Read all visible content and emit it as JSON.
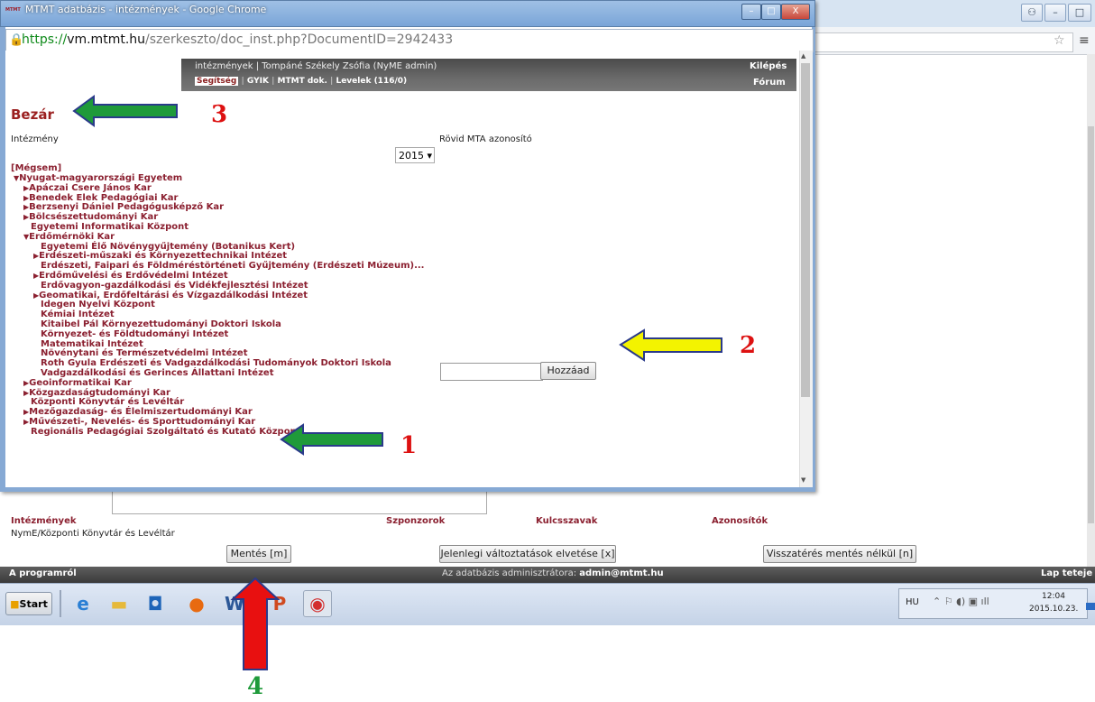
{
  "browser": {
    "window_title": "MTMT adatbázis - intézmények - Google Chrome",
    "favicon_text": "MTMT",
    "url_scheme": "https://",
    "url_host": "vm.mtmt.hu",
    "url_path": "/szerkeszto/doc_inst.php?DocumentID=2942433",
    "minimize": "–",
    "maximize": "□",
    "close": "X"
  },
  "header": {
    "user_line": "intézmények | Tompáné Székely Zsófia (NyME admin)",
    "nav": [
      "Segítség",
      "GYIK",
      "MTMT dok.",
      "Levelek (116/0)"
    ],
    "logout": "Kilépés",
    "forum": "Fórum"
  },
  "form": {
    "close_label": "Bezár",
    "institution_label": "Intézmény",
    "short_id_label": "Rövid MTA azonosító",
    "year": "2015 ▾",
    "cancel_label": "[Mégsem]",
    "add_button": "Hozzáad",
    "add_input_value": ""
  },
  "tree": [
    {
      "level": 0,
      "marker": "▼",
      "label": "Nyugat-magyarországi Egyetem"
    },
    {
      "level": 1,
      "marker": "▶",
      "label": "Apáczai Csere János Kar"
    },
    {
      "level": 1,
      "marker": "▶",
      "label": "Benedek Elek Pedagógiai Kar"
    },
    {
      "level": 1,
      "marker": "▶",
      "label": "Berzsenyi Dániel Pedagógusképző Kar"
    },
    {
      "level": 1,
      "marker": "▶",
      "label": "Bölcsészettudományi Kar"
    },
    {
      "level": 1,
      "marker": "",
      "label": "Egyetemi Informatikai Központ"
    },
    {
      "level": 1,
      "marker": "▼",
      "label": "Erdőmérnöki Kar"
    },
    {
      "level": 2,
      "marker": "",
      "label": "Egyetemi Élő Növénygyűjtemény (Botanikus Kert)"
    },
    {
      "level": 2,
      "marker": "▶",
      "label": "Erdészeti-műszaki és Környezettechnikai Intézet"
    },
    {
      "level": 2,
      "marker": "",
      "label": "Erdészeti, Faipari és Földméréstörténeti Gyűjtemény (Erdészeti Múzeum)..."
    },
    {
      "level": 2,
      "marker": "▶",
      "label": "Erdőművelési és Erdővédelmi Intézet"
    },
    {
      "level": 2,
      "marker": "",
      "label": "Erdővagyon-gazdálkodási és Vidékfejlesztési Intézet"
    },
    {
      "level": 2,
      "marker": "▶",
      "label": "Geomatikai, Erdőfeltárási és Vízgazdálkodási Intézet"
    },
    {
      "level": 2,
      "marker": "",
      "label": "Idegen Nyelvi Központ"
    },
    {
      "level": 2,
      "marker": "",
      "label": "Kémiai Intézet"
    },
    {
      "level": 2,
      "marker": "",
      "label": "Kitaibel Pál Környezettudományi Doktori Iskola"
    },
    {
      "level": 2,
      "marker": "",
      "label": "Környezet- és Földtudományi Intézet"
    },
    {
      "level": 2,
      "marker": "",
      "label": "Matematikai Intézet"
    },
    {
      "level": 2,
      "marker": "",
      "label": "Növénytani és Természetvédelmi Intézet"
    },
    {
      "level": 2,
      "marker": "",
      "label": "Roth Gyula Erdészeti és Vadgazdálkodási Tudományok Doktori Iskola"
    },
    {
      "level": 2,
      "marker": "",
      "label": "Vadgazdálkodási és Gerinces Állattani Intézet"
    },
    {
      "level": 1,
      "marker": "▶",
      "label": "Geoinformatikai Kar"
    },
    {
      "level": 1,
      "marker": "▶",
      "label": "Közgazdaságtudományi Kar"
    },
    {
      "level": 1,
      "marker": "",
      "label": "Központi Könyvtár és Levéltár"
    },
    {
      "level": 1,
      "marker": "▶",
      "label": "Mezőgazdaság- és Élelmiszertudományi Kar"
    },
    {
      "level": 1,
      "marker": "▶",
      "label": "Művészeti-, Nevelés- és Sporttudományi Kar"
    },
    {
      "level": 1,
      "marker": "",
      "label": "Regionális Pedagógiai Szolgáltató és Kutató Központ"
    }
  ],
  "page": {
    "sections": [
      "Intézmények",
      "Szponzorok",
      "Kulcsszavak",
      "Azonosítók"
    ],
    "institution_path": "NymE/Központi Könyvtár és Levéltár",
    "save_button": "Mentés [m]",
    "discard_button": "Jelenlegi változtatások elvetése [x]",
    "back_button": "Visszatérés mentés nélkül [n]",
    "footer_left": "A programról",
    "footer_mid_prefix": "Az adatbázis adminisztrátora: ",
    "footer_mid_email": "admin@mtmt.hu",
    "footer_right": "Lap teteje"
  },
  "taskbar": {
    "start": "Start",
    "apps": [
      "internet-explorer-icon",
      "file-explorer-icon",
      "outlook-icon",
      "firefox-icon",
      "word-icon",
      "powerpoint-icon",
      "chrome-icon"
    ],
    "lang": "HU",
    "time": "12:04",
    "date": "2015.10.23."
  },
  "annotations": [
    {
      "number": "1",
      "color": "#dd1111",
      "arrow_color": "#1f9a3a",
      "points_to": "Központi Könyvtár és Levéltár"
    },
    {
      "number": "2",
      "color": "#dd1111",
      "arrow_color": "#f3f300",
      "points_to": "Hozzáad"
    },
    {
      "number": "3",
      "color": "#dd1111",
      "arrow_color": "#1f9a3a",
      "points_to": "Bezár"
    },
    {
      "number": "4",
      "color": "#1f9a3a",
      "arrow_color": "#e81010",
      "points_to": "Mentés [m]"
    }
  ]
}
